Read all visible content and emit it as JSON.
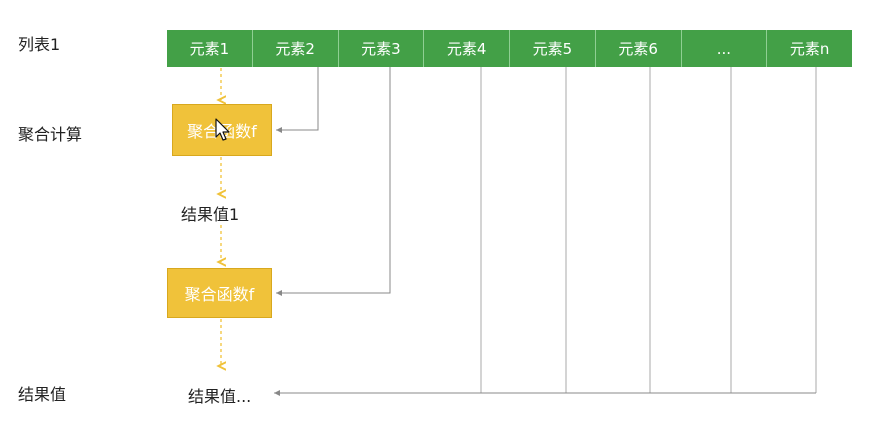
{
  "rows": {
    "list_label": "列表1",
    "aggregate_label": "聚合计算",
    "result_label": "结果值"
  },
  "list": {
    "cells": [
      "元素1",
      "元素2",
      "元素3",
      "元素4",
      "元素5",
      "元素6",
      "...",
      "元素n"
    ]
  },
  "aggregate": {
    "func1_label": "聚合函数f",
    "func2_label": "聚合函数f",
    "intermediate_result": "结果值1",
    "final_result": "结果值..."
  },
  "colors": {
    "list_green": "#43a047",
    "func_yellow": "#f0c23a",
    "line_gray": "#888888",
    "dashed_orange": "#f0c23a"
  },
  "icons": {
    "cursor": "mouse-pointer-icon"
  }
}
